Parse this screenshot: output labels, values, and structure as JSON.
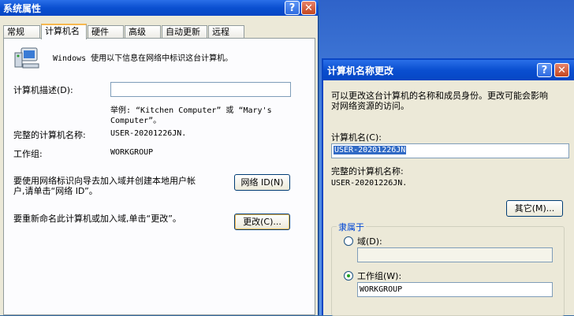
{
  "sys": {
    "title": "系统属性",
    "tabs": [
      "常规",
      "计算机名",
      "硬件",
      "高级",
      "自动更新",
      "远程"
    ],
    "active_tab": 1,
    "intro": "Windows 使用以下信息在网络中标识这台计算机。",
    "desc_label": "计算机描述(D):",
    "desc_value": "",
    "example_line1": "举例: “Kitchen Computer” 或 “Mary's",
    "example_line2": "Computer”。",
    "fullname_label": "完整的计算机名称:",
    "fullname_value": "USER-20201226JN.",
    "workgroup_label": "工作组:",
    "workgroup_value": "WORKGROUP",
    "netid_text1": "要使用网络标识向导去加入域并创建本地用户帐",
    "netid_text2": "户,请单击“网络 ID”。",
    "netid_button": "网络 ID(N)",
    "rename_text": "要重新命名此计算机或加入域,单击“更改”。",
    "change_button": "更改(C)..."
  },
  "rename": {
    "title": "计算机名称更改",
    "intro1": "可以更改这台计算机的名称和成员身份。更改可能会影响",
    "intro2": "对网络资源的访问。",
    "name_label": "计算机名(C):",
    "name_value": "USER-20201226JN",
    "full_label": "完整的计算机名称:",
    "full_value": "USER-20201226JN.",
    "other_button": "其它(M)...",
    "member_legend": "隶属于",
    "domain_label": "域(D):",
    "domain_value": "",
    "workgroup_label": "工作组(W):",
    "workgroup_value": "WORKGROUP",
    "selected": "workgroup"
  },
  "icons": {
    "help": "?",
    "close": "✕"
  }
}
